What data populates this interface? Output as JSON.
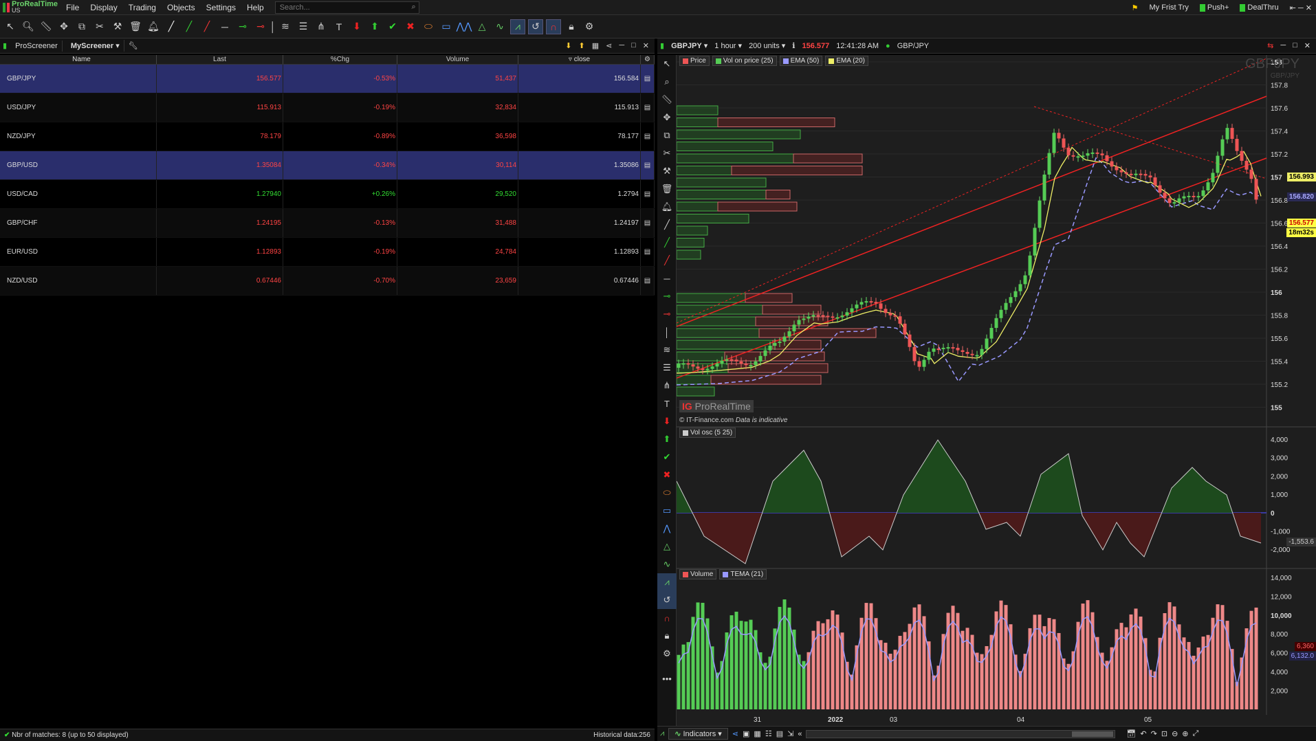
{
  "app": {
    "logo": "ProRealTime",
    "logo_sub": "US"
  },
  "menu": [
    "File",
    "Display",
    "Trading",
    "Objects",
    "Settings",
    "Help"
  ],
  "search": {
    "placeholder": "Search..."
  },
  "topright": [
    "My Frist Try",
    "Push+",
    "DealThru"
  ],
  "screener": {
    "tab1": "ProScreener",
    "tab2": "MyScreener",
    "columns": [
      "Name",
      "Last",
      "%Chg",
      "Volume",
      "close"
    ],
    "rows": [
      {
        "name": "GBP/JPY",
        "last": "156.577",
        "chg": "-0.53%",
        "vol": "51,437",
        "close": "156.584",
        "up": false,
        "sel": true
      },
      {
        "name": "USD/JPY",
        "last": "115.913",
        "chg": "-0.19%",
        "vol": "32,834",
        "close": "115.913",
        "up": false
      },
      {
        "name": "NZD/JPY",
        "last": "78.179",
        "chg": "-0.89%",
        "vol": "36,598",
        "close": "78.177",
        "up": false
      },
      {
        "name": "GBP/USD",
        "last": "1.35084",
        "chg": "-0.34%",
        "vol": "30,114",
        "close": "1.35086",
        "up": false,
        "sel": true
      },
      {
        "name": "USD/CAD",
        "last": "1.27940",
        "chg": "+0.26%",
        "vol": "29,520",
        "close": "1.2794",
        "up": true
      },
      {
        "name": "GBP/CHF",
        "last": "1.24195",
        "chg": "-0.13%",
        "vol": "31,488",
        "close": "1.24197",
        "up": false
      },
      {
        "name": "EUR/USD",
        "last": "1.12893",
        "chg": "-0.19%",
        "vol": "24,784",
        "close": "1.12893",
        "up": false
      },
      {
        "name": "NZD/USD",
        "last": "0.67446",
        "chg": "-0.70%",
        "vol": "23,659",
        "close": "0.67446",
        "up": false
      }
    ],
    "status": "Nbr of matches: 8 (up to 50 displayed)",
    "hist": "Historical data:256"
  },
  "chart": {
    "symbol": "GBPJPY",
    "tf": "1 hour",
    "units": "200 units",
    "price": "156.577",
    "time": "12:41:28 AM",
    "name": "GBP/JPY",
    "watermark": "GBPJPY",
    "watermark_sub": "GBP/JPY",
    "legend_price": [
      "Price",
      "Vol on price (25)",
      "EMA (50)",
      "EMA (20)"
    ],
    "legend_osc": [
      "Vol osc (5 25)"
    ],
    "legend_vol": [
      "Volume",
      "TEMA (21)"
    ],
    "brand": "ProRealTime",
    "brand_prefix": "IG",
    "source": "© IT-Finance.com",
    "indicative": "Data is indicative",
    "price_ticks": [
      "158",
      "157.8",
      "157.6",
      "157.4",
      "157.2",
      "157",
      "156.8",
      "156.6",
      "156.4",
      "156.2",
      "156",
      "155.8",
      "155.6",
      "155.4",
      "155.2",
      "155"
    ],
    "osc_ticks": [
      "4,000",
      "3,000",
      "2,000",
      "1,000",
      "0",
      "-1,000",
      "-2,000"
    ],
    "vol_ticks": [
      "14,000",
      "12,000",
      "10,000",
      "8,000",
      "6,000",
      "4,000",
      "2,000"
    ],
    "tags": {
      "ema50": "156.993",
      "ema20": "156.820",
      "last": "156.577",
      "countdown": "18m32s",
      "osc": "-1,553.6",
      "vol": "6,360",
      "tema": "6,132.0"
    },
    "xlabels": [
      "31",
      "2022",
      "03",
      "04",
      "05"
    ],
    "indicators": "Indicators"
  }
}
